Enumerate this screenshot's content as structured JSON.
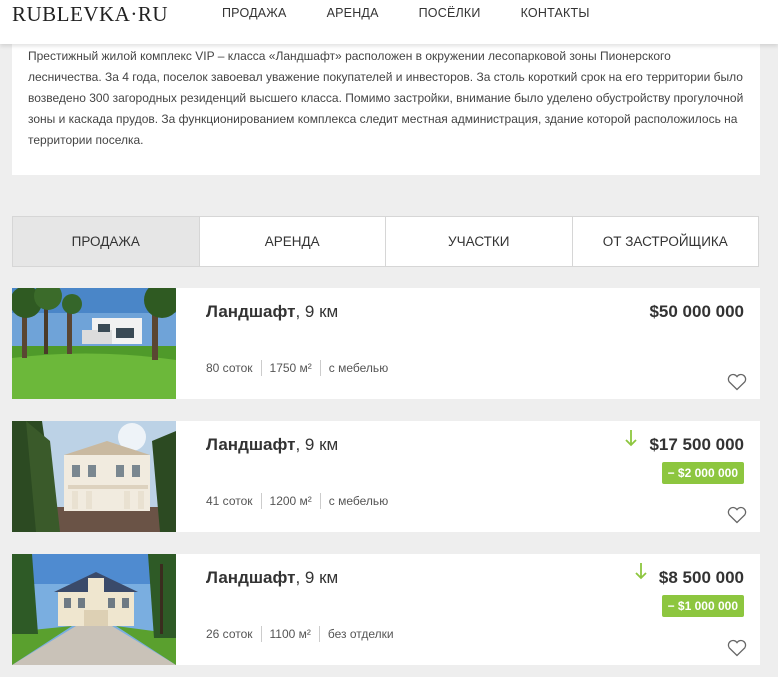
{
  "header": {
    "logo": "RUBLEVKA·RU",
    "nav": [
      "ПРОДАЖА",
      "АРЕНДА",
      "ПОСЁЛКИ",
      "КОНТАКТЫ"
    ]
  },
  "description": "Престижный жилой комплекс VIP – класса «Ландшафт» расположен в окружении лесопарковой зоны Пионерского лесничества. За 4 года, поселок завоевал уважение покупателей и инвесторов. За столь короткий срок на его территории было возведено 300 загородных резиденций высшего класса. Помимо застройки, внимание было уделено обустройству прогулочной зоны и каскада прудов. За функционированием комплекса следит местная администрация, здание которой расположилось на территории поселка.",
  "tabs": [
    "ПРОДАЖА",
    "АРЕНДА",
    "УЧАСТКИ",
    "ОТ ЗАСТРОЙЩИКА"
  ],
  "active_tab": "ПРОДАЖА",
  "listings": [
    {
      "name": "Ландшафт",
      "distance": ", 9 км",
      "area_land": "80 соток",
      "area_house": "1750 м²",
      "finish": "с мебелью",
      "price": "$50 000 000",
      "discount": "",
      "price_dropped": false
    },
    {
      "name": "Ландшафт",
      "distance": ", 9 км",
      "area_land": "41 соток",
      "area_house": "1200 м²",
      "finish": "с мебелью",
      "price": "$17 500 000",
      "discount": "− $2 000 000",
      "price_dropped": true
    },
    {
      "name": "Ландшафт",
      "distance": ", 9 км",
      "area_land": "26 соток",
      "area_house": "1100 м²",
      "finish": "без отделки",
      "price": "$8 500 000",
      "discount": "− $1 000 000",
      "price_dropped": true
    }
  ],
  "icons": {
    "favorite": "heart-icon",
    "price_drop": "arrow-down-icon"
  },
  "colors": {
    "accent_green": "#8dc63f",
    "background": "#eeeeee",
    "active_tab": "#e6e6e6"
  }
}
